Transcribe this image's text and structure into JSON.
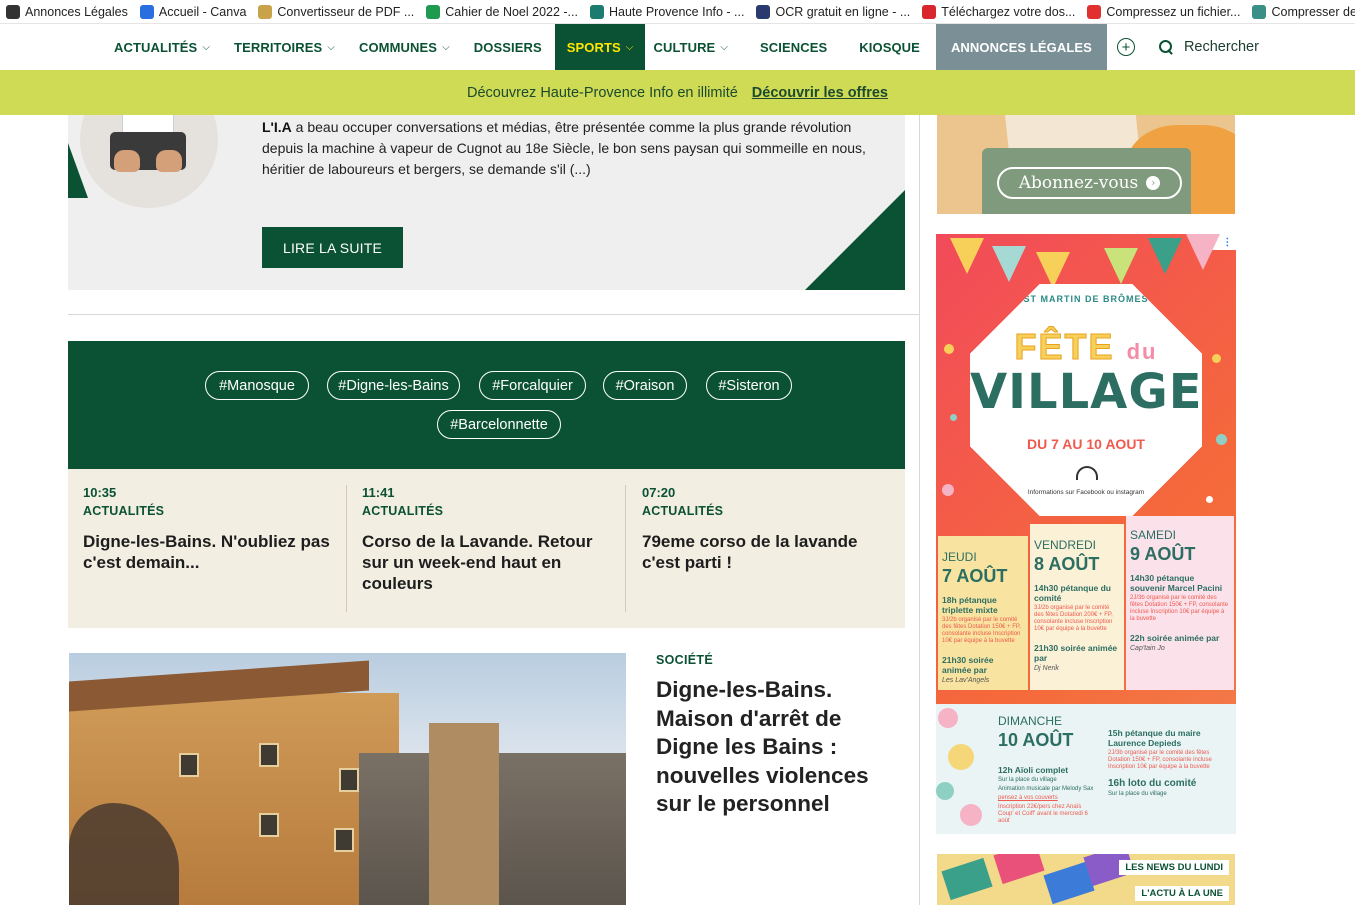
{
  "bookmarks": [
    {
      "label": "Annonces Légales",
      "icon": "home-icon",
      "color": "#333333"
    },
    {
      "label": "Accueil - Canva",
      "icon": "canva-icon",
      "color": "#2a6fe0"
    },
    {
      "label": "Convertisseur de PDF ...",
      "icon": "pdf-icon",
      "color": "#c8a34a"
    },
    {
      "label": "Cahier de Noel 2022 -...",
      "icon": "sheets-icon",
      "color": "#1e9b4f"
    },
    {
      "label": "Haute Provence Info - ...",
      "icon": "sharepoint-icon",
      "color": "#1b7b6f"
    },
    {
      "label": "OCR gratuit en ligne - ...",
      "icon": "ocr-icon",
      "color": "#2b3a6e"
    },
    {
      "label": "Téléchargez votre dos...",
      "icon": "download-icon",
      "color": "#d8262c"
    },
    {
      "label": "Compressez un fichier...",
      "icon": "heart-icon",
      "color": "#e03030"
    },
    {
      "label": "Compresser des Imag...",
      "icon": "image-icon",
      "color": "#3a8f86"
    }
  ],
  "nav": {
    "items": [
      {
        "label": "ACTUALITÉS",
        "has_menu": true
      },
      {
        "label": "TERRITOIRES",
        "has_menu": true
      },
      {
        "label": "COMMUNES",
        "has_menu": true
      },
      {
        "label": "DOSSIERS",
        "has_menu": false
      },
      {
        "label": "SPORTS",
        "has_menu": true,
        "active": true
      },
      {
        "label": "CULTURE",
        "has_menu": true
      },
      {
        "label": "SCIENCES",
        "has_menu": false
      },
      {
        "label": "KIOSQUE",
        "has_menu": false
      },
      {
        "label": "ANNONCES LÉGALES",
        "has_menu": false
      }
    ],
    "plus_glyph": "+",
    "search_label": "Rechercher",
    "chevron": "⌵"
  },
  "promo": {
    "text": "Découvrez Haute-Provence Info en illimité",
    "link": "Découvrir les offres"
  },
  "article_top": {
    "excerpt_bold": "L'I.A",
    "excerpt": " a beau occuper conversations et médias, être présentée comme la plus grande révolution depuis la machine à vapeur de Cugnot au 18e Siècle, le bon sens paysan qui sommeille en nous, héritier de laboureurs et bergers, se demande s'il (...)",
    "button": "LIRE LA SUITE"
  },
  "tags": [
    "#Manosque",
    "#Digne-les-Bains",
    "#Forcalquier",
    "#Oraison",
    "#Sisteron",
    "#Barcelonnette"
  ],
  "latest": [
    {
      "time": "10:35",
      "category": "ACTUALITÉS",
      "title": "Digne-les-Bains. N'oubliez pas c'est demain..."
    },
    {
      "time": "11:41",
      "category": "ACTUALITÉS",
      "title": "Corso de la Lavande. Retour sur un week-end haut en couleurs"
    },
    {
      "time": "07:20",
      "category": "ACTUALITÉS",
      "title": "79eme corso de la lavande c'est parti !"
    }
  ],
  "featured": {
    "category": "SOCIÉTÉ",
    "title": "Digne-les-Bains. Maison d'arrêt de Digne les Bains : nouvelles violences sur le personnel"
  },
  "ads": {
    "subscribe": {
      "button": "Abonnez-vous",
      "arrow": "›"
    },
    "village": {
      "adchoice": [
        "▷",
        "⋮"
      ],
      "place": "ST MARTIN DE BRÔMES",
      "fete": "FÊTE",
      "du": "du",
      "village": "VILLAGE",
      "dates": "DU 7 AU 10 AOUT",
      "info": "Informations sur Facebook ou instagram",
      "days": [
        {
          "name": "JEUDI",
          "num": "7 AOÛT",
          "ev": "18h pétanque triplette mixte",
          "sm": "3J/2b organisé par le comité des fêtes Dotation 150€ + FP, consolante incluse Inscription 10€ par équipe à la buvette",
          "ev2": "21h30 soirée animée par",
          "who": "Les Lav'Angels"
        },
        {
          "name": "VENDREDI",
          "num": "8 AOÛT",
          "ev": "14h30 pétanque du comité",
          "sm": "3J/2b organisé par le comité des fêtes Dotation 200€ + FP, consolante incluse Inscription 10€ par équipe à la buvette",
          "ev2": "21h30 soirée animée par",
          "who": "Dj Nerik"
        },
        {
          "name": "SAMEDI",
          "num": "9 AOÛT",
          "ev": "14h30 pétanque souvenir Marcel Pacini",
          "sm": "2J/3b organisé par le comité des fêtes Dotation 150€ + FP, consolante incluse Inscription 10€ par équipe à la buvette",
          "ev2": "22h soirée animée par",
          "who": "Cap'tain Jo"
        }
      ],
      "sunday": {
        "name": "DIMANCHE",
        "num": "10 AOÛT",
        "ev1": "12h Aïoli complet",
        "ev1_sub": "Sur la place du village",
        "ev1_music": "Animation musicale par Melody Sax",
        "ev1_cutlery": "pensez à vos couverts",
        "ev1_signup": "Inscription 22€/pers chez Anaïs Coup' et Coiff' avant le mercredi 6 août",
        "ev2": "15h pétanque du maire Laurence Depieds",
        "ev2_sub": "2J/3b organisé par le comité des fêtes Dotation 150€ + FP, consolante incluse Inscription 10€ par équipe à la buvette",
        "ev3": "16h loto du comité",
        "ev3_sub": "Sur la place du village"
      }
    },
    "news": {
      "label1": "LES NEWS DU LUNDI",
      "label2": "L'ACTU À LA UNE"
    }
  }
}
